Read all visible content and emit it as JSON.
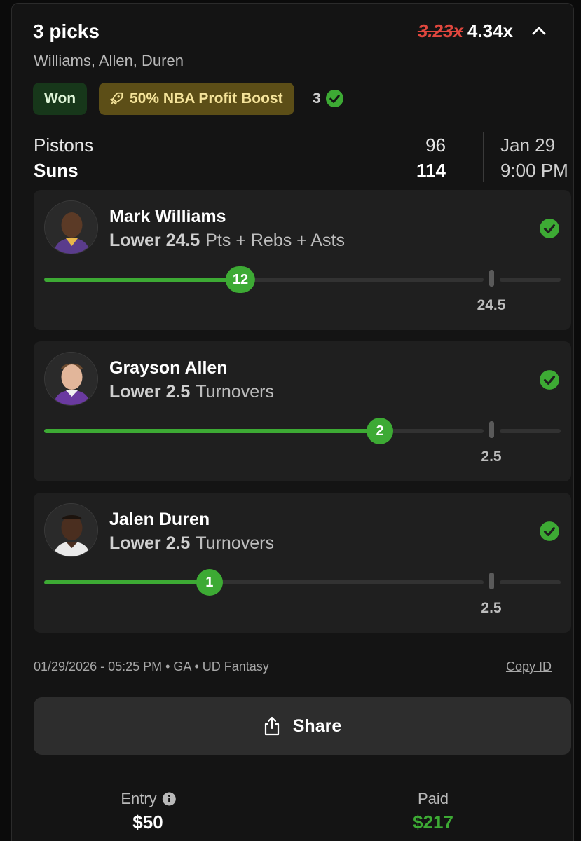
{
  "header": {
    "title": "3 picks",
    "old_multiplier": "3.23x",
    "new_multiplier": "4.34x",
    "players_summary": "Williams, Allen, Duren"
  },
  "badges": {
    "status": "Won",
    "boost": "50% NBA Profit Boost",
    "correct_count": "3"
  },
  "game": {
    "away_team": "Pistons",
    "home_team": "Suns",
    "away_score": "96",
    "home_score": "114",
    "date": "Jan 29",
    "time": "9:00 PM"
  },
  "picks": [
    {
      "player": "Mark Williams",
      "direction": "Lower",
      "line": "24.5",
      "stat": "Pts + Rebs + Asts",
      "actual": "12",
      "line_label": "24.5",
      "fill_fraction": 0.38
    },
    {
      "player": "Grayson Allen",
      "direction": "Lower",
      "line": "2.5",
      "stat": "Turnovers",
      "actual": "2",
      "line_label": "2.5",
      "fill_fraction": 0.65
    },
    {
      "player": "Jalen Duren",
      "direction": "Lower",
      "line": "2.5",
      "stat": "Turnovers",
      "actual": "1",
      "line_label": "2.5",
      "fill_fraction": 0.32
    }
  ],
  "footer": {
    "meta": "01/29/2026 - 05:25 PM • GA • UD Fantasy",
    "copy_id": "Copy ID",
    "share": "Share",
    "entry_label": "Entry",
    "entry_value": "$50",
    "paid_label": "Paid",
    "paid_value": "$217"
  },
  "colors": {
    "accent_green": "#3daa34",
    "strike_red": "#e0473e",
    "boost_bg": "#5c4e17"
  },
  "icons": {
    "collapse": "chevron-up-icon",
    "boost": "rocket-icon",
    "correct": "check-circle-icon",
    "share": "share-icon",
    "info": "info-icon"
  }
}
